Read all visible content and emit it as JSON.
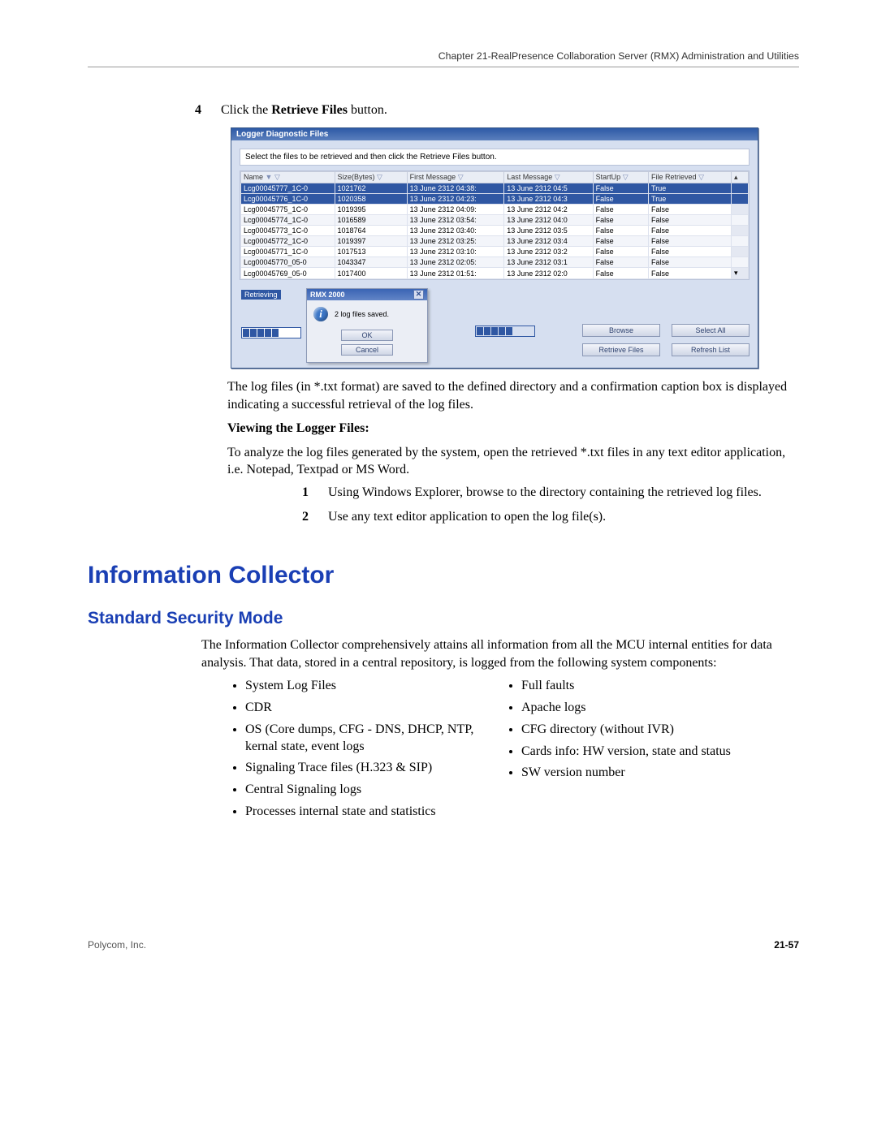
{
  "header": {
    "chapter": "Chapter 21-RealPresence Collaboration Server (RMX) Administration and Utilities"
  },
  "step4": {
    "num": "4",
    "pre": "Click the ",
    "bold": "Retrieve Files",
    "post": " button."
  },
  "appwin": {
    "title": "Logger Diagnostic Files",
    "instruction": "Select the files to be retrieved and then click the Retrieve Files button.",
    "columns": {
      "name": "Name",
      "size": "Size(Bytes)",
      "first": "First Message",
      "last": "Last Message",
      "startup": "StartUp",
      "retrieved": "File Retrieved"
    },
    "rows": [
      {
        "name": "Lcg00045777_1C-0",
        "size": "1021762",
        "first": "13 June 2312 04:38:",
        "last": "13 June 2312 04:5",
        "startup": "False",
        "retrieved": "True",
        "sel": true,
        "alt": false
      },
      {
        "name": "Lcg00045776_1C-0",
        "size": "1020358",
        "first": "13 June 2312 04:23:",
        "last": "13 June 2312 04:3",
        "startup": "False",
        "retrieved": "True",
        "sel": true,
        "alt": true
      },
      {
        "name": "Lcg00045775_1C-0",
        "size": "1019395",
        "first": "13 June 2312 04:09:",
        "last": "13 June 2312 04:2",
        "startup": "False",
        "retrieved": "False",
        "sel": false,
        "alt": false
      },
      {
        "name": "Lcg00045774_1C-0",
        "size": "1016589",
        "first": "13 June 2312 03:54:",
        "last": "13 June 2312 04:0",
        "startup": "False",
        "retrieved": "False",
        "sel": false,
        "alt": true
      },
      {
        "name": "Lcg00045773_1C-0",
        "size": "1018764",
        "first": "13 June 2312 03:40:",
        "last": "13 June 2312 03:5",
        "startup": "False",
        "retrieved": "False",
        "sel": false,
        "alt": false
      },
      {
        "name": "Lcg00045772_1C-0",
        "size": "1019397",
        "first": "13 June 2312 03:25:",
        "last": "13 June 2312 03:4",
        "startup": "False",
        "retrieved": "False",
        "sel": false,
        "alt": true
      },
      {
        "name": "Lcg00045771_1C-0",
        "size": "1017513",
        "first": "13 June 2312 03:10:",
        "last": "13 June 2312 03:2",
        "startup": "False",
        "retrieved": "False",
        "sel": false,
        "alt": false
      },
      {
        "name": "Lcg00045770_05-0",
        "size": "1043347",
        "first": "13 June 2312 02:05:",
        "last": "13 June 2312 03:1",
        "startup": "False",
        "retrieved": "False",
        "sel": false,
        "alt": true
      },
      {
        "name": "Lcg00045769_05-0",
        "size": "1017400",
        "first": "13 June 2312 01:51:",
        "last": "13 June 2312 02:0",
        "startup": "False",
        "retrieved": "False",
        "sel": false,
        "alt": false
      }
    ],
    "retrieving_label": "Retrieving",
    "msgbox": {
      "title": "RMX 2000",
      "text": "2 log files saved.",
      "ok": "OK",
      "cancel": "Cancel"
    },
    "buttons": {
      "browse": "Browse",
      "select_all": "Select All",
      "retrieve": "Retrieve Files",
      "refresh": "Refresh List"
    }
  },
  "after_screenshot": "The log files (in *.txt format) are saved to the defined directory and a confirmation caption box is displayed indicating a successful retrieval of the log files.",
  "viewing_heading": "Viewing the Logger Files:",
  "viewing_text": "To analyze the log files generated by the system, open the retrieved *.txt files in any text editor application, i.e. Notepad, Textpad or MS Word.",
  "steps_view": [
    {
      "num": "1",
      "text": "Using Windows Explorer, browse to the directory containing the retrieved log files."
    },
    {
      "num": "2",
      "text": "Use any text editor application to open the log file(s)."
    }
  ],
  "section_h1": "Information Collector",
  "section_h2": "Standard Security Mode",
  "section_intro": "The Information Collector comprehensively attains all information from all the MCU internal entities for data analysis. That data, stored in a central repository, is logged from the following system components:",
  "bullets_left": [
    "System Log Files",
    "CDR",
    "OS (Core dumps, CFG - DNS, DHCP, NTP, kernal state, event logs",
    "Signaling Trace files (H.323 & SIP)",
    "Central Signaling logs",
    "Processes internal state and statistics"
  ],
  "bullets_right": [
    "Full faults",
    "Apache logs",
    "CFG directory (without IVR)",
    "Cards info: HW version, state and status",
    "SW version number"
  ],
  "footer": {
    "company": "Polycom, Inc.",
    "page": "21-57"
  }
}
